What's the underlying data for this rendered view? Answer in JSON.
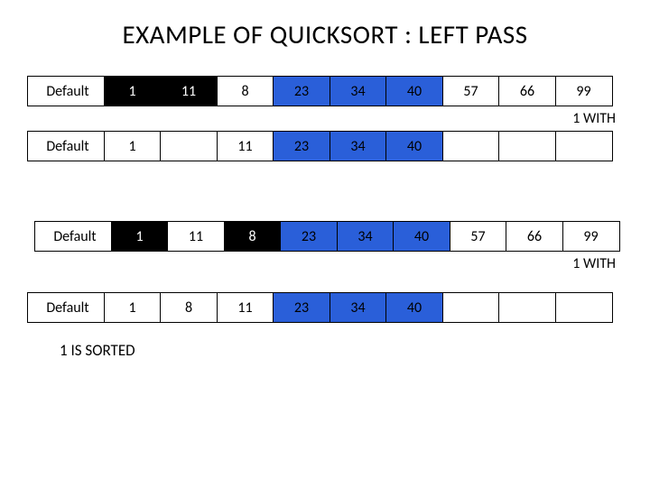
{
  "title": "EXAMPLE OF QUICKSORT : LEFT PASS",
  "notes": {
    "with1": "1 WITH",
    "sorted": "1 IS SORTED"
  },
  "rows": [
    {
      "label": "Default",
      "cells": [
        {
          "v": "1",
          "c": "black"
        },
        {
          "v": "11",
          "c": "black"
        },
        {
          "v": "8",
          "c": "white"
        },
        {
          "v": "23",
          "c": "blue"
        },
        {
          "v": "34",
          "c": "blue"
        },
        {
          "v": "40",
          "c": "blue"
        },
        {
          "v": "57",
          "c": "white"
        },
        {
          "v": "66",
          "c": "white"
        },
        {
          "v": "99",
          "c": "white"
        }
      ]
    },
    {
      "label": "Default",
      "cells": [
        {
          "v": "1",
          "c": "white"
        },
        {
          "v": "",
          "c": "white"
        },
        {
          "v": "11",
          "c": "white"
        },
        {
          "v": "23",
          "c": "blue"
        },
        {
          "v": "34",
          "c": "blue"
        },
        {
          "v": "40",
          "c": "blue"
        },
        {
          "v": "",
          "c": "white"
        },
        {
          "v": "",
          "c": "white"
        },
        {
          "v": "",
          "c": "white"
        }
      ]
    },
    {
      "label": "Default",
      "cells": [
        {
          "v": "1",
          "c": "black"
        },
        {
          "v": "11",
          "c": "white"
        },
        {
          "v": "8",
          "c": "black"
        },
        {
          "v": "23",
          "c": "blue"
        },
        {
          "v": "34",
          "c": "blue"
        },
        {
          "v": "40",
          "c": "blue"
        },
        {
          "v": "57",
          "c": "white"
        },
        {
          "v": "66",
          "c": "white"
        },
        {
          "v": "99",
          "c": "white"
        }
      ]
    },
    {
      "label": "Default",
      "cells": [
        {
          "v": "1",
          "c": "white"
        },
        {
          "v": "8",
          "c": "white"
        },
        {
          "v": "11",
          "c": "white"
        },
        {
          "v": "23",
          "c": "blue"
        },
        {
          "v": "34",
          "c": "blue"
        },
        {
          "v": "40",
          "c": "blue"
        },
        {
          "v": "",
          "c": "white"
        },
        {
          "v": "",
          "c": "white"
        },
        {
          "v": "",
          "c": "white"
        }
      ]
    }
  ]
}
